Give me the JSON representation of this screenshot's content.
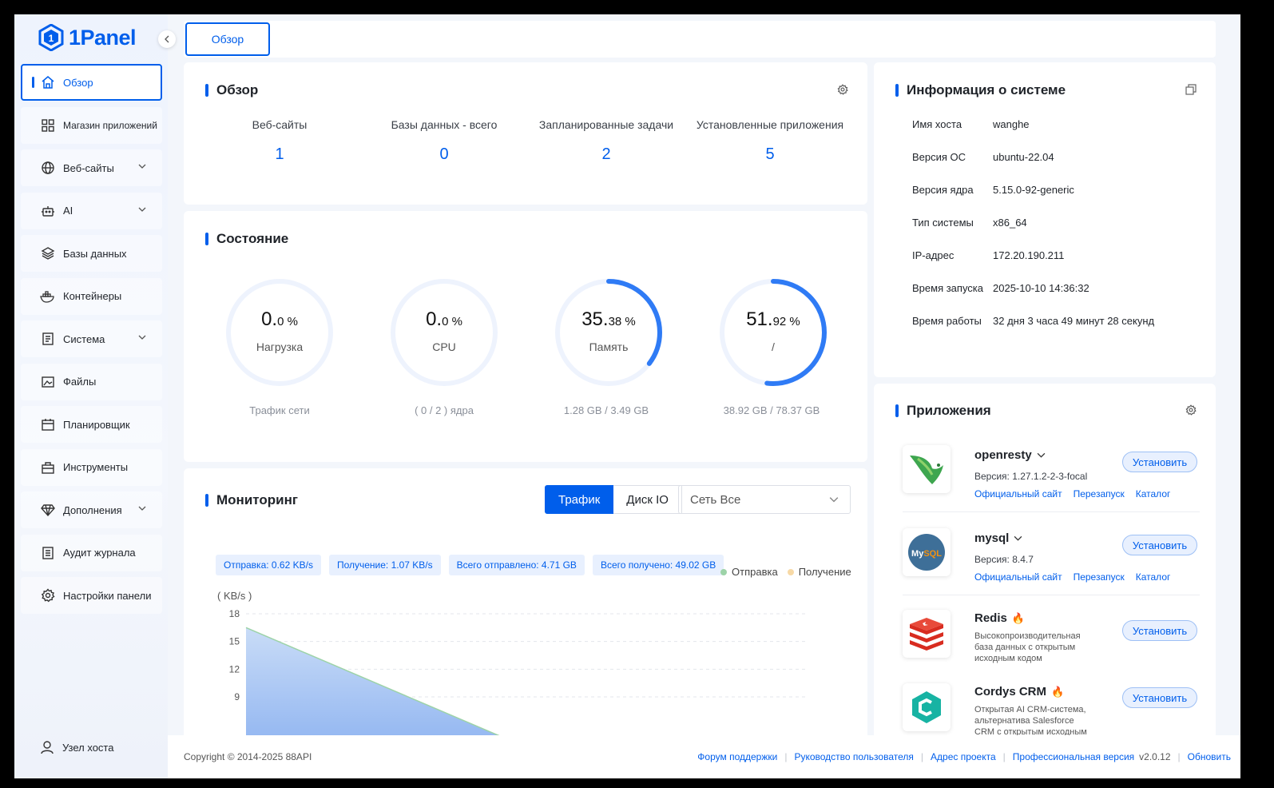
{
  "brand": {
    "name": "1Panel",
    "accent": "#005eeb"
  },
  "sidebar": {
    "items": [
      {
        "label": "Обзор",
        "icon": "home-icon",
        "active": true
      },
      {
        "label": "Магазин приложений",
        "icon": "grid-icon"
      },
      {
        "label": "Веб-сайты",
        "icon": "globe-icon",
        "expandable": true
      },
      {
        "label": "AI",
        "icon": "robot-icon",
        "expandable": true
      },
      {
        "label": "Базы данных",
        "icon": "layers-icon"
      },
      {
        "label": "Контейнеры",
        "icon": "docker-icon"
      },
      {
        "label": "Система",
        "icon": "file-list-icon",
        "expandable": true
      },
      {
        "label": "Файлы",
        "icon": "image-file-icon"
      },
      {
        "label": "Планировщик",
        "icon": "calendar-icon"
      },
      {
        "label": "Инструменты",
        "icon": "toolbox-icon"
      },
      {
        "label": "Дополнения",
        "icon": "diamond-icon",
        "expandable": true
      },
      {
        "label": "Аудит журнала",
        "icon": "log-icon"
      },
      {
        "label": "Настройки панели",
        "icon": "gear-icon"
      }
    ],
    "host_node": "Узел хоста"
  },
  "tabs": {
    "active": "Обзор"
  },
  "overview": {
    "title": "Обзор",
    "stats": [
      {
        "label": "Веб-сайты",
        "value": "1"
      },
      {
        "label": "Базы данных - всего",
        "value": "0"
      },
      {
        "label": "Запланированные задачи",
        "value": "2"
      },
      {
        "label": "Установленные приложения",
        "value": "5"
      }
    ]
  },
  "status": {
    "title": "Состояние",
    "gauges": [
      {
        "int": "0.",
        "dec": "0 %",
        "name": "Нагрузка",
        "sub": "Трафик сети",
        "percent": 0
      },
      {
        "int": "0.",
        "dec": "0 %",
        "name": "CPU",
        "sub": "( 0 / 2 ) ядра",
        "percent": 0
      },
      {
        "int": "35.",
        "dec": "38 %",
        "name": "Память",
        "sub": "1.28 GB / 3.49 GB",
        "percent": 35.38
      },
      {
        "int": "51.",
        "dec": "92 %",
        "name": "/",
        "sub": "38.92 GB / 78.37 GB",
        "percent": 51.92
      }
    ]
  },
  "monitoring": {
    "title": "Мониторинг",
    "tabs": [
      "Трафик",
      "Диск IO"
    ],
    "select_label": "Сеть",
    "select_value": "Все",
    "tags": [
      "Отправка: 0.62 KB/s",
      "Получение: 1.07 KB/s",
      "Всего отправлено: 4.71 GB",
      "Всего получено: 49.02 GB"
    ],
    "legend": [
      "Отправка",
      "Получение"
    ]
  },
  "chart_data": {
    "type": "area",
    "ylabel": "( KB/s )",
    "yticks": [
      18,
      15,
      12,
      9
    ],
    "ylim": [
      0,
      18
    ],
    "series": [
      {
        "name": "Отправка",
        "color": "#9dd3a8",
        "values": [
          16.5,
          8.2
        ]
      },
      {
        "name": "Получение",
        "color": "#f7d9a6",
        "values": [
          16.5,
          8.2
        ]
      }
    ]
  },
  "sysinfo": {
    "title": "Информация о системе",
    "rows": [
      {
        "k": "Имя хоста",
        "v": "wanghe"
      },
      {
        "k": "Версия ОС",
        "v": "ubuntu-22.04"
      },
      {
        "k": "Версия ядра",
        "v": "5.15.0-92-generic"
      },
      {
        "k": "Тип системы",
        "v": "x86_64"
      },
      {
        "k": "IP-адрес",
        "v": "172.20.190.211"
      },
      {
        "k": "Время запуска",
        "v": "2025-10-10 14:36:32"
      },
      {
        "k": "Время работы",
        "v": "32 дня 3 часа 49 минут 28 секунд"
      }
    ]
  },
  "apps": {
    "title": "Приложения",
    "install_label": "Установить",
    "links": [
      "Официальный сайт",
      "Перезапуск",
      "Каталог"
    ],
    "items": [
      {
        "name": "openresty",
        "version": "Версия: 1.27.1.2-2-3-focal"
      },
      {
        "name": "mysql",
        "version": "Версия: 8.4.7"
      },
      {
        "name": "Redis",
        "desc": "Высокопроизводительная база данных с открытым исходным кодом"
      },
      {
        "name": "Cordys CRM",
        "desc": "Открытая AI CRM-система, альтернатива Salesforce CRM с открытым исходным кодом"
      }
    ]
  },
  "footer": {
    "copyright": "Copyright © 2014-2025 88API",
    "links": [
      "Форум поддержки",
      "Руководство пользователя",
      "Адрес проекта",
      "Профессиональная версия"
    ],
    "version": "v2.0.12",
    "update": "Обновить"
  }
}
